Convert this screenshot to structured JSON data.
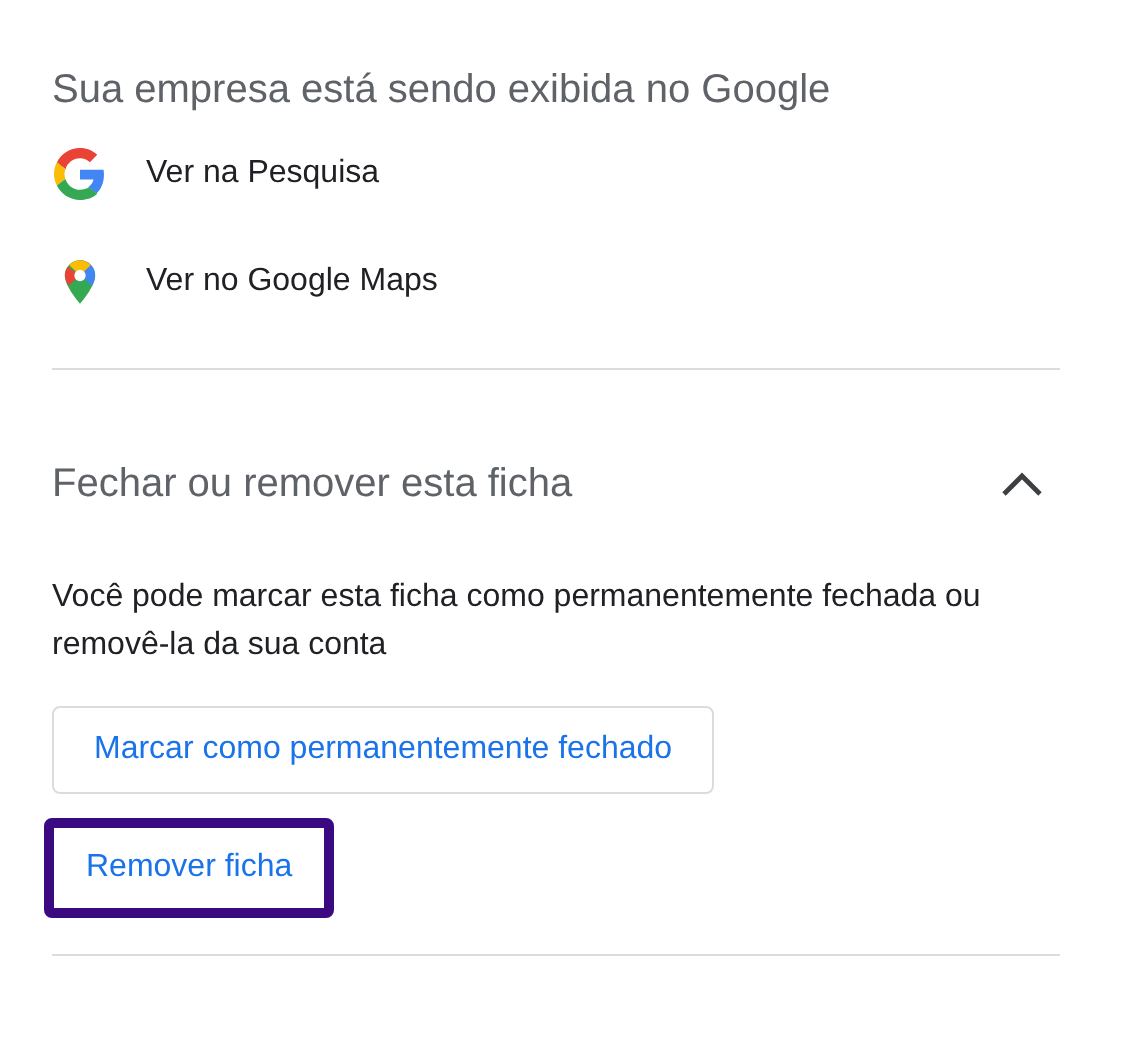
{
  "presence": {
    "title": "Sua empresa está sendo exibida no Google",
    "links": [
      {
        "kind": "search",
        "label": "Ver na Pesquisa"
      },
      {
        "kind": "maps",
        "label": "Ver no Google Maps"
      }
    ]
  },
  "close_section": {
    "title": "Fechar ou remover esta ficha",
    "expanded": true,
    "description": "Você pode marcar esta ficha como permanentemente fechada ou removê-la da sua conta",
    "buttons": [
      {
        "label": "Marcar como permanentemente fechado",
        "outlined": true,
        "highlighted": false
      },
      {
        "label": "Remover ficha",
        "outlined": false,
        "highlighted": true
      }
    ]
  }
}
